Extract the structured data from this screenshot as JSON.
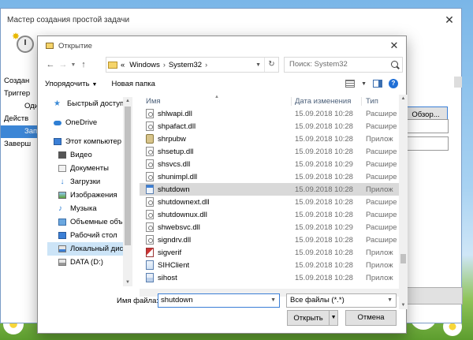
{
  "wizard": {
    "title": "Мастер создания простой задачи",
    "steps": [
      "Создан",
      "Триггер",
      "Один",
      "Действ",
      "Запу",
      "Заверш"
    ],
    "browse_label": "Обзор..."
  },
  "dialog": {
    "title": "Открытие",
    "breadcrumb": [
      "Windows",
      "System32"
    ],
    "breadcrumb_prefix": "«",
    "search_placeholder": "Поиск: System32",
    "toolbar": {
      "organize": "Упорядочить",
      "new_folder": "Новая папка"
    },
    "nav": {
      "quick_access": "Быстрый доступ",
      "onedrive": "OneDrive",
      "this_pc": "Этот компьютер",
      "video": "Видео",
      "documents": "Документы",
      "downloads": "Загрузки",
      "pictures": "Изображения",
      "music": "Музыка",
      "objects3d": "Объемные объ",
      "desktop": "Рабочий стол",
      "local_disk": "Локальный дис",
      "data_drive": "DATA (D:)"
    },
    "columns": {
      "name": "Имя",
      "date": "Дата изменения",
      "type": "Тип"
    },
    "files": [
      {
        "name": "shlwapi.dll",
        "date": "15.09.2018 10:28",
        "type": "Расшире",
        "icon": "dll"
      },
      {
        "name": "shpafact.dll",
        "date": "15.09.2018 10:28",
        "type": "Расшире",
        "icon": "dll"
      },
      {
        "name": "shrpubw",
        "date": "15.09.2018 10:28",
        "type": "Прилож",
        "icon": "shr"
      },
      {
        "name": "shsetup.dll",
        "date": "15.09.2018 10:28",
        "type": "Расшире",
        "icon": "dll"
      },
      {
        "name": "shsvcs.dll",
        "date": "15.09.2018 10:29",
        "type": "Расшире",
        "icon": "dll"
      },
      {
        "name": "shunimpl.dll",
        "date": "15.09.2018 10:28",
        "type": "Расшире",
        "icon": "dll"
      },
      {
        "name": "shutdown",
        "date": "15.09.2018 10:28",
        "type": "Прилож",
        "icon": "exe"
      },
      {
        "name": "shutdownext.dll",
        "date": "15.09.2018 10:28",
        "type": "Расшире",
        "icon": "dll"
      },
      {
        "name": "shutdownux.dll",
        "date": "15.09.2018 10:28",
        "type": "Расшире",
        "icon": "dll"
      },
      {
        "name": "shwebsvc.dll",
        "date": "15.09.2018 10:29",
        "type": "Расшире",
        "icon": "dll"
      },
      {
        "name": "signdrv.dll",
        "date": "15.09.2018 10:28",
        "type": "Расшире",
        "icon": "dll"
      },
      {
        "name": "sigverif",
        "date": "15.09.2018 10:28",
        "type": "Прилож",
        "icon": "sig"
      },
      {
        "name": "SIHClient",
        "date": "15.09.2018 10:28",
        "type": "Прилож",
        "icon": "app"
      },
      {
        "name": "sihost",
        "date": "15.09.2018 10:28",
        "type": "Прилож",
        "icon": "host"
      }
    ],
    "selected_file": "shutdown",
    "filename_label": "Имя файла:",
    "filename_value": "shutdown",
    "filter_value": "Все файлы (*.*)",
    "open_label": "Открыть",
    "cancel_label": "Отмена"
  }
}
